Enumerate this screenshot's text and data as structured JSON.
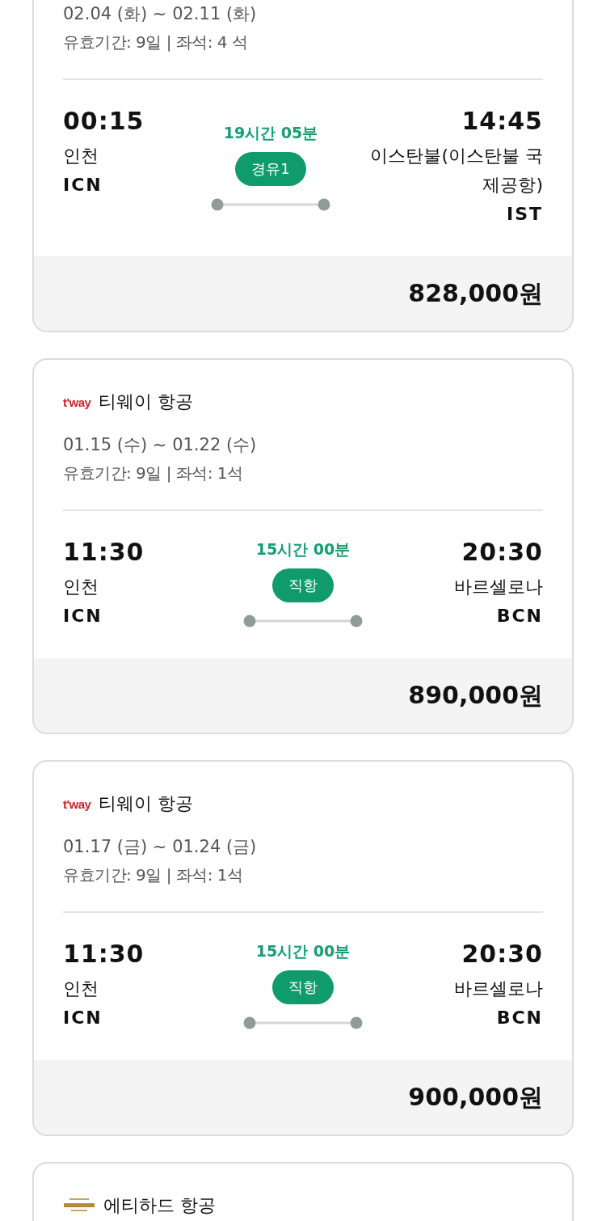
{
  "flights": [
    {
      "dates": "02.04 (화) ~ 02.11 (화)",
      "validity": "유효기간: 9일 | 좌석: 4 석",
      "departure": {
        "time": "00:15",
        "city": "인천",
        "code": "ICN"
      },
      "duration": "19시간 05분",
      "stops": "경유1",
      "arrival": {
        "time": "14:45",
        "city": "이스탄불(이스탄불 국제공항)",
        "code": "IST"
      },
      "price": "828,000원"
    },
    {
      "airline": {
        "logo": {
          "kind": "wordmark",
          "text": "t'way"
        },
        "name": "티웨이 항공"
      },
      "dates": "01.15 (수) ~ 01.22 (수)",
      "validity": "유효기간: 9일 | 좌석: 1석",
      "departure": {
        "time": "11:30",
        "city": "인천",
        "code": "ICN"
      },
      "duration": "15시간 00분",
      "stops": "직항",
      "arrival": {
        "time": "20:30",
        "city": "바르셀로나",
        "code": "BCN"
      },
      "price": "890,000원"
    },
    {
      "airline": {
        "logo": {
          "kind": "wordmark",
          "text": "t'way"
        },
        "name": "티웨이 항공"
      },
      "dates": "01.17 (금) ~ 01.24 (금)",
      "validity": "유효기간: 9일 | 좌석: 1석",
      "departure": {
        "time": "11:30",
        "city": "인천",
        "code": "ICN"
      },
      "duration": "15시간 00분",
      "stops": "직항",
      "arrival": {
        "time": "20:30",
        "city": "바르셀로나",
        "code": "BCN"
      },
      "price": "900,000원"
    },
    {
      "airline": {
        "logo": {
          "kind": "emblem"
        },
        "name": "에티하드 항공"
      }
    }
  ]
}
